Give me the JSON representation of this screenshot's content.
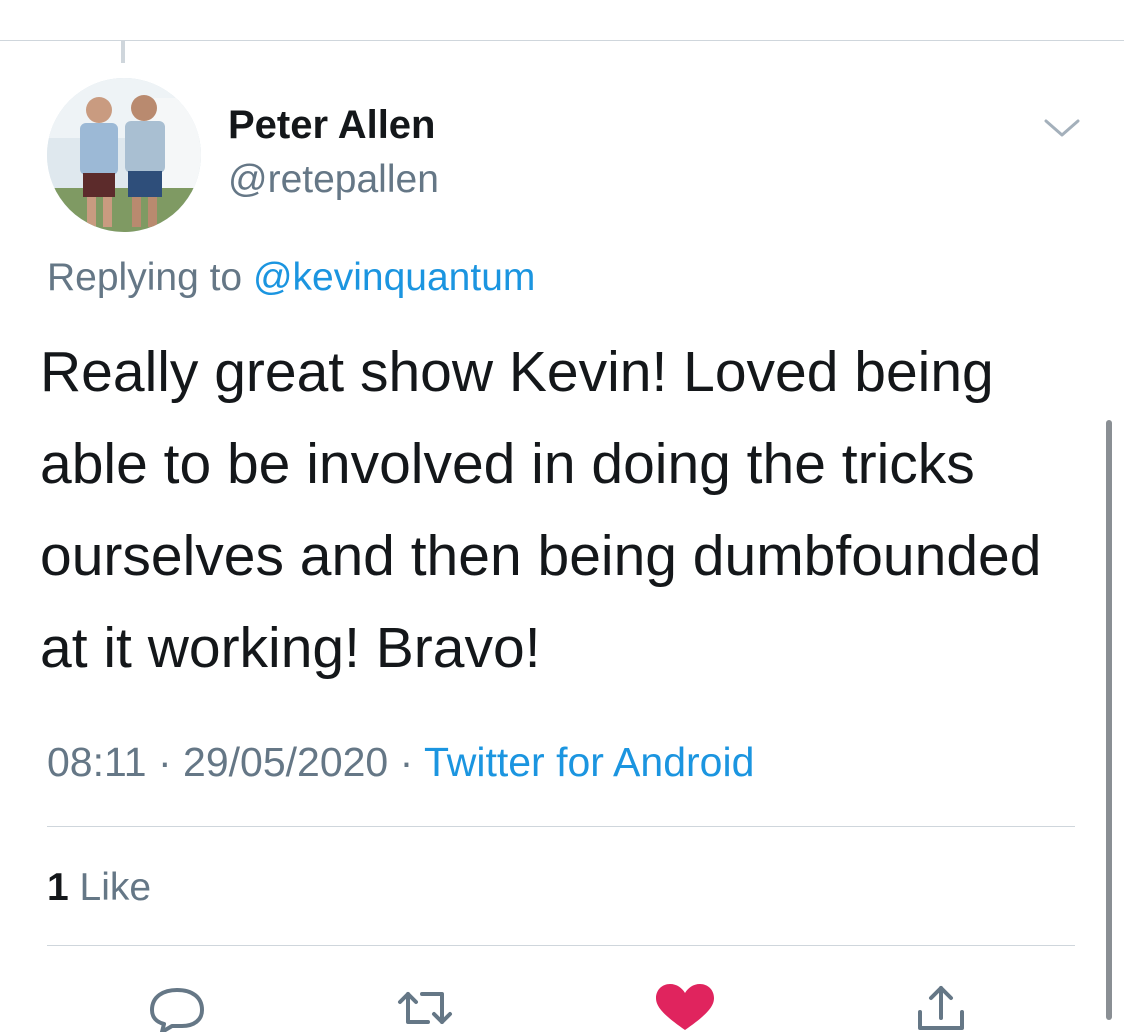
{
  "tweet": {
    "author": {
      "display_name": "Peter Allen",
      "handle": "@retepallen",
      "avatar_icon": "profile-photo"
    },
    "replying_prefix": "Replying to",
    "replying_to": "@kevinquantum",
    "text": "Really great show Kevin! Loved being able to be involved in doing the tricks ourselves and then being dumbfounded at it working! Bravo!",
    "time": "08:11",
    "date": "29/05/2020",
    "separator": "·",
    "source": "Twitter for Android",
    "like_count": "1",
    "like_label": "Like"
  },
  "actions": [
    {
      "name": "reply",
      "icon": "reply-icon"
    },
    {
      "name": "retweet",
      "icon": "retweet-icon"
    },
    {
      "name": "like",
      "icon": "heart-icon",
      "active": true
    },
    {
      "name": "share",
      "icon": "share-icon"
    }
  ],
  "colors": {
    "text": "#14171a",
    "secondary": "#657786",
    "link": "#1b95e0",
    "like_active": "#e0245e",
    "divider": "#cfd6dc"
  }
}
